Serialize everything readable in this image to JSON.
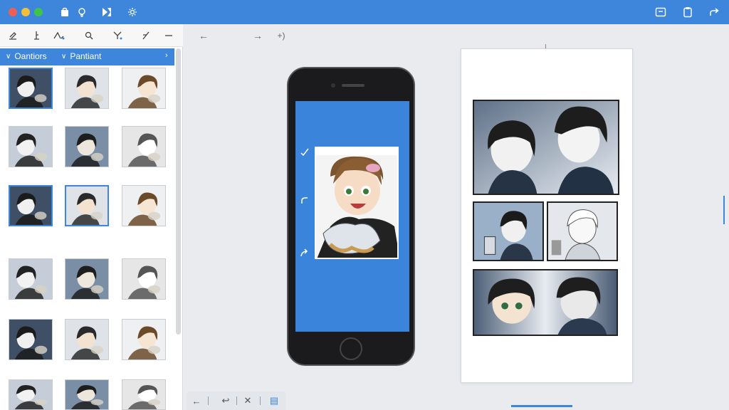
{
  "window": {
    "controls": [
      "close",
      "minimize",
      "maximize"
    ],
    "colors": {
      "titlebar": "#3d86dc",
      "close": "#ed5e55",
      "minimize": "#f4be3a",
      "maximize": "#3fc44b",
      "accent": "#3d86dc"
    },
    "left_icons": [
      "bag-icon",
      "bulb-icon",
      "flag-icon",
      "gear-icon"
    ],
    "right_icons": [
      "window-icon",
      "clipboard-icon",
      "share-icon"
    ]
  },
  "toolbar": {
    "tools": [
      "edit-tool-icon",
      "anchor-tool-icon",
      "bend-tool-icon",
      "brush-tool-icon",
      "scissors-tool-icon",
      "slash-tool-icon",
      "minus-tool-icon"
    ]
  },
  "tabs": [
    {
      "label": "Oantiors"
    },
    {
      "label": "Pantiant"
    }
  ],
  "nav": {
    "back": "←",
    "forward": "→",
    "redo": "+)"
  },
  "bottom_bar": {
    "items": [
      "←",
      "↩",
      "✕",
      "▤"
    ]
  }
}
